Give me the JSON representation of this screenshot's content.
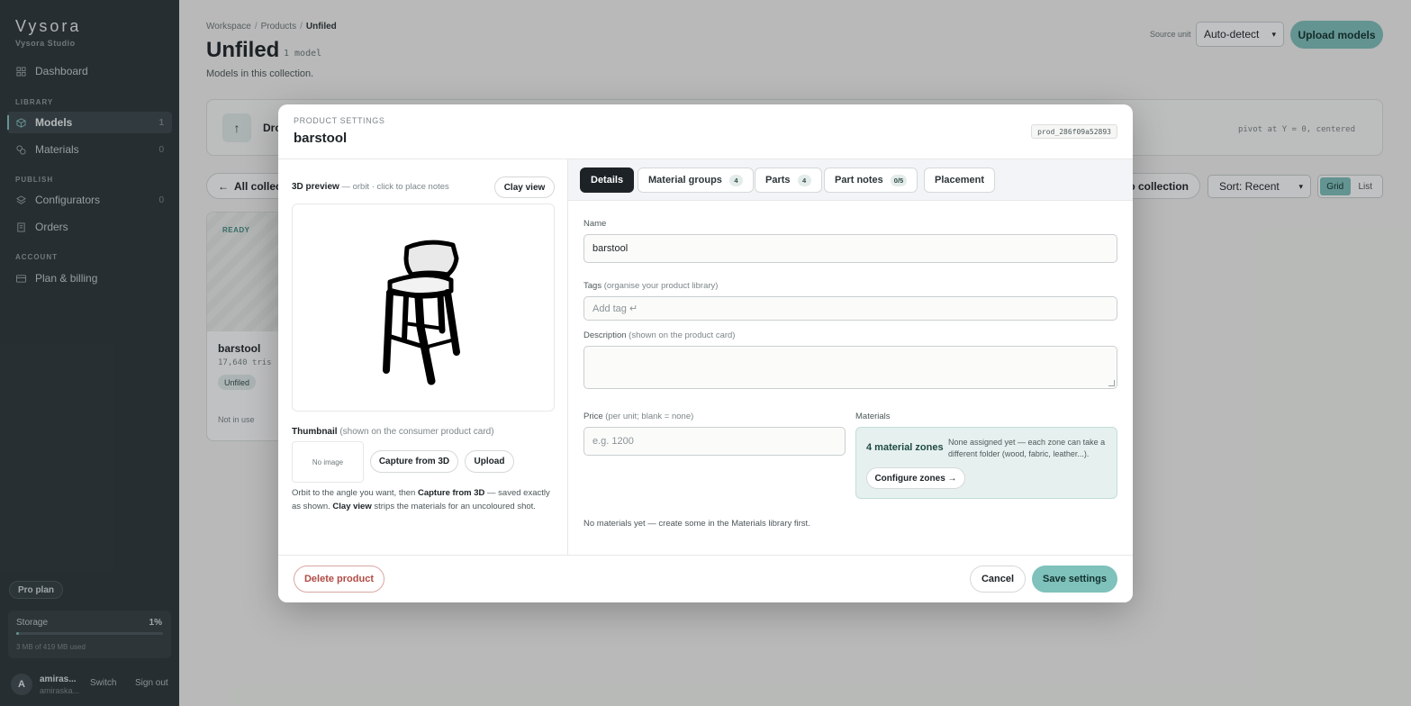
{
  "sidebar": {
    "brand": "Vysora",
    "brand_sub": "Vysora Studio",
    "dashboard": "Dashboard",
    "section_library": "LIBRARY",
    "models": "Models",
    "models_count": "1",
    "materials": "Materials",
    "materials_count": "0",
    "section_publish": "PUBLISH",
    "configurators": "Configurators",
    "configurators_count": "0",
    "orders": "Orders",
    "section_account": "ACCOUNT",
    "billing": "Plan & billing",
    "plan": "Pro plan",
    "storage_label": "Storage",
    "storage_pct": "1%",
    "storage_fraction": 0.01,
    "storage_used": "3 MB of 419 MB used",
    "user_initial": "A",
    "user_name": "amiras...",
    "user_email": "amiraska...",
    "switch": "Switch",
    "signout": "Sign out"
  },
  "page": {
    "crumb_1": "Workspace",
    "crumb_2": "Products",
    "crumb_3": "Unfiled",
    "crumb_sep": "/",
    "title": "Unfiled",
    "count": "1 model",
    "subtitle": "Models in this collection.",
    "source_unit_label": "Source unit",
    "source_unit_value": "Auto-detect",
    "upload": "Upload models",
    "drop_text": "Dro",
    "pivot": "pivot at Y = 0, centered",
    "all_collections": "All collec",
    "to_collection": "to collection",
    "sort": "Sort: Recent",
    "view_grid": "Grid",
    "view_list": "List",
    "card": {
      "status": "READY",
      "name": "barstool",
      "tris": "17,640 tris ·",
      "tag": "Unfiled",
      "usage": "Not in use"
    }
  },
  "modal": {
    "eyebrow": "PRODUCT SETTINGS",
    "title": "barstool",
    "product_id": "prod_286f09a52893",
    "preview_label": "3D preview",
    "preview_hint": " — orbit · click to place notes",
    "clay_view": "Clay view",
    "thumbnail_label": "Thumbnail",
    "thumbnail_hint": " (shown on the consumer product card)",
    "no_image": "No image",
    "capture": "Capture from 3D",
    "upload": "Upload",
    "help_1": "Orbit to the angle you want, then ",
    "help_2": "Capture from 3D",
    "help_3": " — saved exactly as shown. ",
    "help_4": "Clay view",
    "help_5": " strips the materials for an uncoloured shot.",
    "tabs": {
      "details": "Details",
      "material_groups": "Material groups",
      "material_groups_badge": "4",
      "parts": "Parts",
      "parts_badge": "4",
      "part_notes": "Part notes",
      "part_notes_badge": "0/5",
      "placement": "Placement"
    },
    "name_label": "Name",
    "name_value": "barstool",
    "tags_label": "Tags",
    "tags_hint": " (organise your product library)",
    "tags_placeholder": "Add tag ↵",
    "desc_label": "Description",
    "desc_hint": " (shown on the product card)",
    "price_label": "Price",
    "price_hint": " (per unit; blank = none)",
    "price_placeholder": "e.g. 1200",
    "materials_label": "Materials",
    "material_zones": "4 material zones",
    "material_note": "None assigned yet — each zone can take a different folder (wood, fabric, leather...).",
    "configure_zones": "Configure zones →",
    "no_materials": "No materials yet — create some in the Materials library first.",
    "delete": "Delete product",
    "cancel": "Cancel",
    "save": "Save settings"
  }
}
